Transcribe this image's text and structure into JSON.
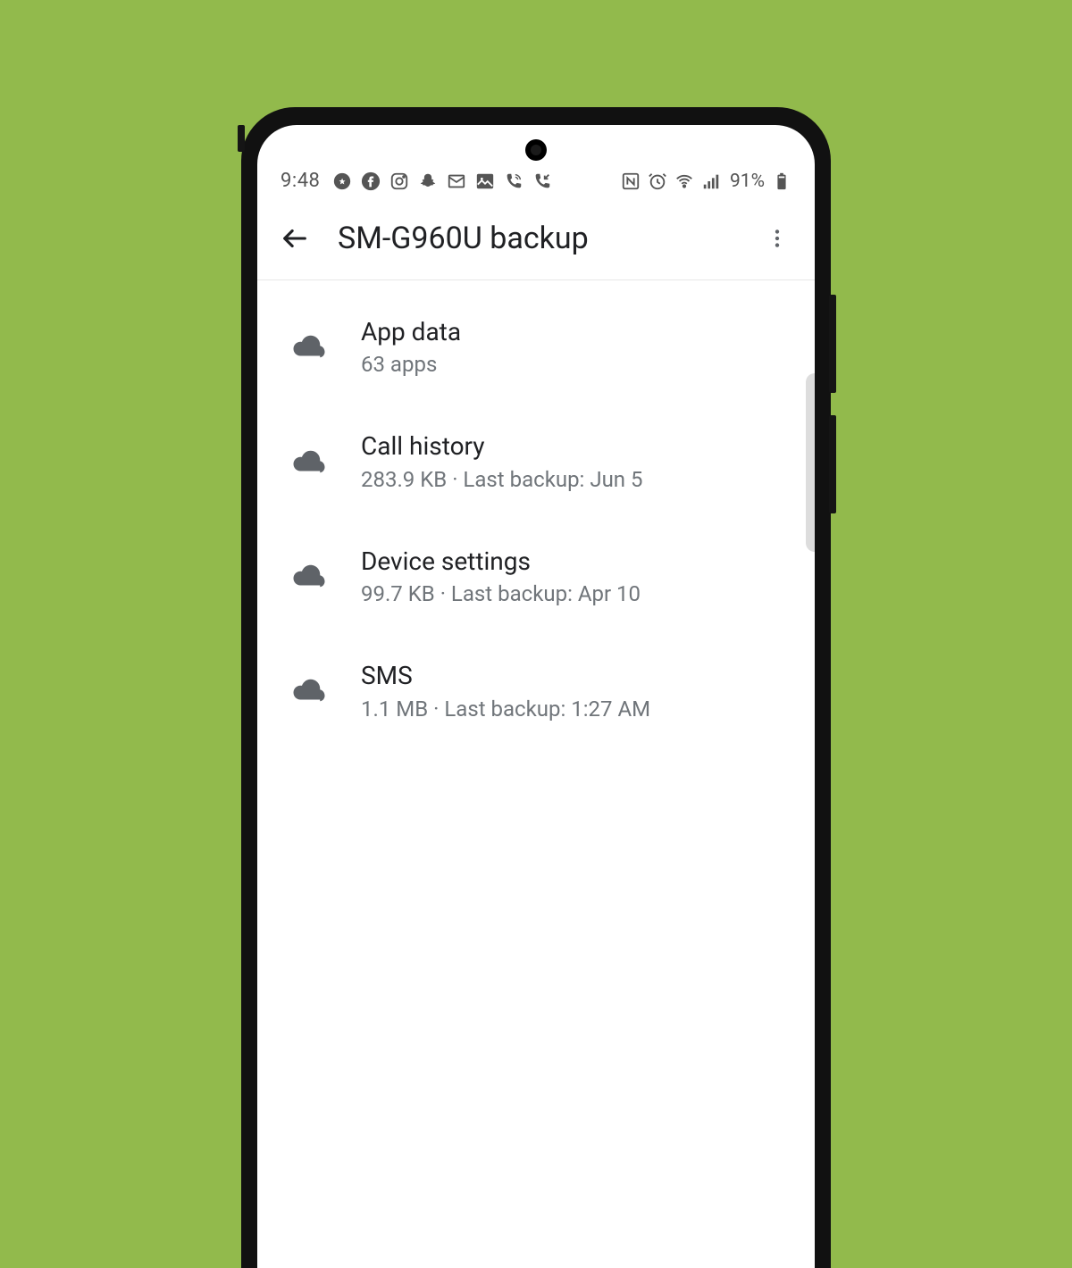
{
  "status": {
    "time": "9:48",
    "battery": "91%",
    "left_icons": [
      "compass",
      "facebook",
      "instagram",
      "snapchat",
      "mail",
      "photo",
      "phone-missed",
      "phone-in"
    ],
    "right_icons": [
      "nfc",
      "alarm",
      "wifi",
      "signal"
    ]
  },
  "appbar": {
    "title": "SM-G960U backup"
  },
  "backup_items": [
    {
      "title": "App data",
      "subtitle": "63 apps"
    },
    {
      "title": "Call history",
      "subtitle": "283.9 KB · Last backup: Jun 5"
    },
    {
      "title": "Device settings",
      "subtitle": "99.7 KB · Last backup: Apr 10"
    },
    {
      "title": "SMS",
      "subtitle": "1.1 MB · Last backup: 1:27 AM"
    }
  ]
}
